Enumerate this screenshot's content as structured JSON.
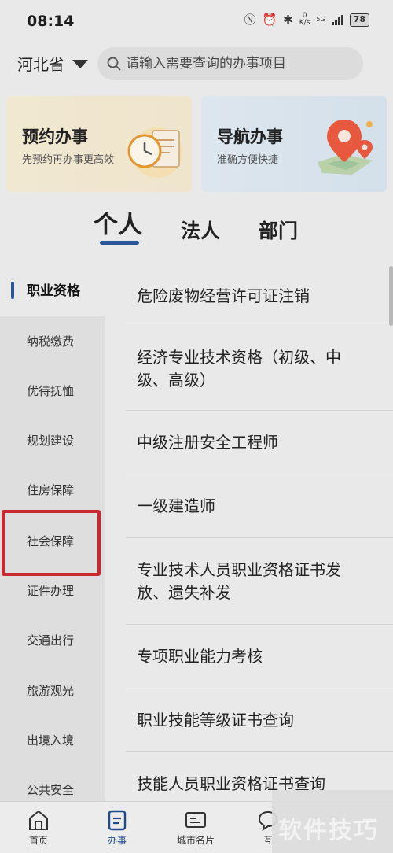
{
  "status_bar": {
    "time": "08:14",
    "speed_value": "0",
    "speed_unit": "K/s",
    "network": "5G",
    "battery": "78"
  },
  "header": {
    "region": "河北省",
    "search_placeholder": "请输入需要查询的办事项目"
  },
  "banners": [
    {
      "title": "预约办事",
      "subtitle": "先预约再办事更高效"
    },
    {
      "title": "导航办事",
      "subtitle": "准确方便快捷"
    }
  ],
  "tabs": [
    {
      "label": "个人"
    },
    {
      "label": "法人"
    },
    {
      "label": "部门"
    }
  ],
  "categories": [
    {
      "label": "职业资格"
    },
    {
      "label": "纳税缴费"
    },
    {
      "label": "优待抚恤"
    },
    {
      "label": "规划建设"
    },
    {
      "label": "住房保障"
    },
    {
      "label": "社会保障"
    },
    {
      "label": "证件办理"
    },
    {
      "label": "交通出行"
    },
    {
      "label": "旅游观光"
    },
    {
      "label": "出境入境"
    },
    {
      "label": "公共安全"
    }
  ],
  "items": [
    {
      "label": "危险废物经营许可证注销"
    },
    {
      "label": "经济专业技术资格（初级、中级、高级）"
    },
    {
      "label": "中级注册安全工程师"
    },
    {
      "label": "一级建造师"
    },
    {
      "label": "专业技术人员职业资格证书发放、遗失补发"
    },
    {
      "label": "专项职业能力考核"
    },
    {
      "label": "职业技能等级证书查询"
    },
    {
      "label": "技能人员职业资格证书查询"
    }
  ],
  "bottom_nav": [
    {
      "label": "首页",
      "icon": "home-icon"
    },
    {
      "label": "办事",
      "icon": "service-icon"
    },
    {
      "label": "城市名片",
      "icon": "city-card-icon"
    },
    {
      "label": "互",
      "icon": "interact-icon"
    }
  ],
  "watermark": "软件技巧",
  "colors": {
    "accent": "#2e5596",
    "highlight": "#c8282e",
    "background": "#e9e9e9",
    "sidebar": "#dedede"
  }
}
